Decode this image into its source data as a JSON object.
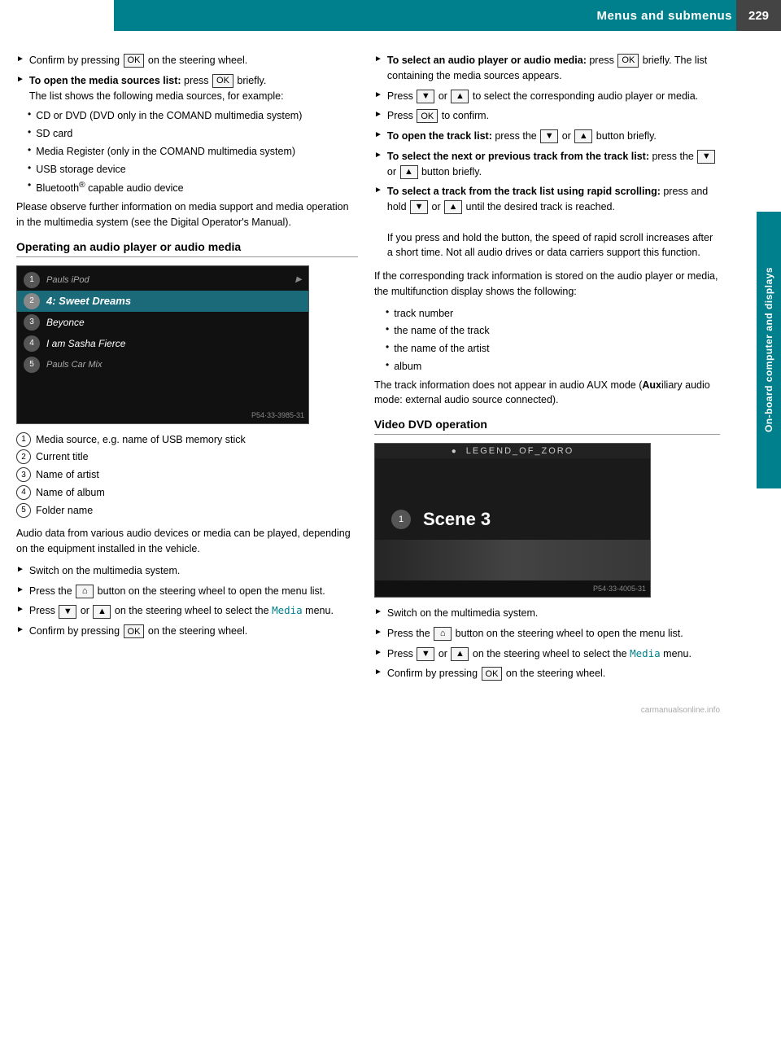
{
  "header": {
    "title": "Menus and submenus",
    "page_number": "229"
  },
  "side_tab": {
    "label": "On-board computer and displays"
  },
  "left_col": {
    "bullets": [
      {
        "id": "confirm-ok",
        "text": "Confirm by pressing OK on the steering wheel."
      },
      {
        "id": "open-media-list",
        "bold_prefix": "To open the media sources list:",
        "text": " press OK briefly.",
        "sub_note": "The list shows the following media sources, for example:"
      }
    ],
    "sub_bullets": [
      "CD or DVD (DVD only in the COMAND multimedia system)",
      "SD card",
      "Media Register (only in the COMAND multimedia system)",
      "USB storage device",
      "Bluetooth® capable audio device"
    ],
    "info_para": "Please observe further information on media support and media operation in the multimedia system (see the Digital Operator's Manual).",
    "section_heading": "Operating an audio player or audio media",
    "media_image": {
      "top_label": "Pauls iPod",
      "items": [
        {
          "num": "1",
          "label": "Pauls iPod",
          "active": false
        },
        {
          "num": "2",
          "label": "4: Sweet Dreams",
          "active": true
        },
        {
          "num": "3",
          "label": "Beyonce",
          "active": false
        },
        {
          "num": "4",
          "label": "I am Sasha Fierce",
          "active": false
        },
        {
          "num": "5",
          "label": "Pauls Car Mix",
          "active": false
        }
      ],
      "caption": "P54·33-3985-31"
    },
    "legend_items": [
      {
        "num": "1",
        "text": "Media source, e.g. name of USB memory stick"
      },
      {
        "num": "2",
        "text": "Current title"
      },
      {
        "num": "3",
        "text": "Name of artist"
      },
      {
        "num": "4",
        "text": "Name of album"
      },
      {
        "num": "5",
        "text": "Folder name"
      }
    ],
    "audio_para": "Audio data from various audio devices or media can be played, depending on the equipment installed in the vehicle.",
    "bottom_bullets": [
      {
        "id": "switch-multimedia",
        "text": "Switch on the multimedia system."
      },
      {
        "id": "press-home",
        "text": "Press the ⌂ button on the steering wheel to open the menu list."
      },
      {
        "id": "press-nav-media",
        "text": "Press ▼ or ▲ on the steering wheel to select the Media menu."
      },
      {
        "id": "confirm-ok2",
        "text": "Confirm by pressing OK on the steering wheel."
      }
    ]
  },
  "right_col": {
    "bullets_top": [
      {
        "id": "select-audio",
        "bold_prefix": "To select an audio player or audio media:",
        "text": " press OK briefly. The list containing the media sources appears."
      },
      {
        "id": "press-nav-select",
        "text": "Press ▼ or ▲ to select the corresponding audio player or media."
      },
      {
        "id": "press-ok-confirm",
        "text": "Press OK to confirm."
      },
      {
        "id": "open-track-list",
        "bold_prefix": "To open the track list:",
        "text": " press the ▼ or ▲ button briefly."
      },
      {
        "id": "select-next-prev",
        "bold_prefix": "To select the next or previous track from the track list:",
        "text": " press the ▼ or ▲ button briefly."
      },
      {
        "id": "select-track-rapid",
        "bold_prefix": "To select a track from the track list using rapid scrolling:",
        "text": " press and hold ▼ or ▲ until the desired track is reached.",
        "note": "If you press and hold the button, the speed of rapid scroll increases after a short time. Not all audio drives or data carriers support this function."
      }
    ],
    "info_para": "If the corresponding track information is stored on the audio player or media, the multifunction display shows the following:",
    "info_list": [
      "track number",
      "the name of the track",
      "the name of the artist",
      "album"
    ],
    "aux_para": "The track information does not appear in audio AUX mode (Auxiliary audio mode: external audio source connected).",
    "video_section_heading": "Video DVD operation",
    "video_image": {
      "top_label": "LEGEND_OF_ZORO",
      "item_num": "1",
      "item_label": "Scene 3",
      "caption": "P54·33-4005-31"
    },
    "bottom_bullets": [
      {
        "id": "switch-multimedia-v",
        "text": "Switch on the multimedia system."
      },
      {
        "id": "press-home-v",
        "text": "Press the ⌂ button on the steering wheel to open the menu list."
      },
      {
        "id": "press-nav-media-v",
        "text": "Press ▼ or ▲ on the steering wheel to select the Media menu."
      },
      {
        "id": "confirm-ok-v",
        "text": "Confirm by pressing OK on the steering wheel."
      }
    ]
  },
  "keys": {
    "ok": "OK",
    "down": "▼",
    "up": "▲",
    "home": "⌂"
  }
}
